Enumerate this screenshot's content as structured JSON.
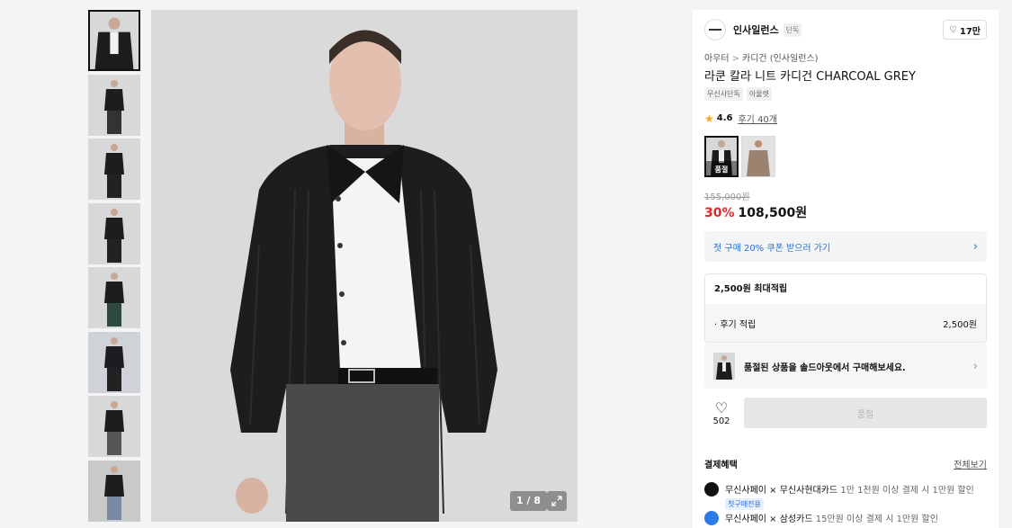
{
  "gallery": {
    "counter": "1 / 8",
    "thumbnail_count": 8
  },
  "brand": {
    "name": "인사일런스",
    "badge": "단독",
    "likes": "17만"
  },
  "breadcrumb": {
    "level1": "아우터",
    "separator": ">",
    "level2": "카디건 (인사일런스)"
  },
  "product": {
    "title": "라쿤 칼라 니트 카디건 CHARCOAL GREY",
    "tags": [
      "무신사단독",
      "아울렛"
    ],
    "rating": "4.6",
    "reviews": "후기 40개",
    "color_options": [
      {
        "label": "품절",
        "selected": true
      },
      {
        "label": "",
        "selected": false
      }
    ],
    "original_price": "155,000원",
    "discount": "30%",
    "price": "108,500원"
  },
  "coupon": {
    "text": "첫 구매 20% 쿠폰 받으러 가기"
  },
  "points": {
    "header": "2,500원 최대적립",
    "row_label": "· 후기 적립",
    "row_value": "2,500원"
  },
  "soldout_notice": {
    "text": "품절된 상품을 솔드아웃에서 구매해보세요."
  },
  "actions": {
    "like_count": "502",
    "buy_button": "품절"
  },
  "payment": {
    "title": "결제혜택",
    "view_all": "전체보기",
    "items": [
      {
        "name": "무신사페이 × 무신사현대카드",
        "desc": "1만 1천원 이상 결제 시 1만원 할인",
        "chip": "첫구매전용",
        "icon_color": "#111111"
      },
      {
        "name": "무신사페이 × 삼성카드",
        "desc": "15만원 이상 결제 시 1만원 할인",
        "chip": "",
        "icon_color": "#2d7be5"
      }
    ]
  },
  "colors": {
    "discount_red": "#e4262b",
    "link_blue": "#2b6fd6",
    "star": "#f5a623"
  }
}
